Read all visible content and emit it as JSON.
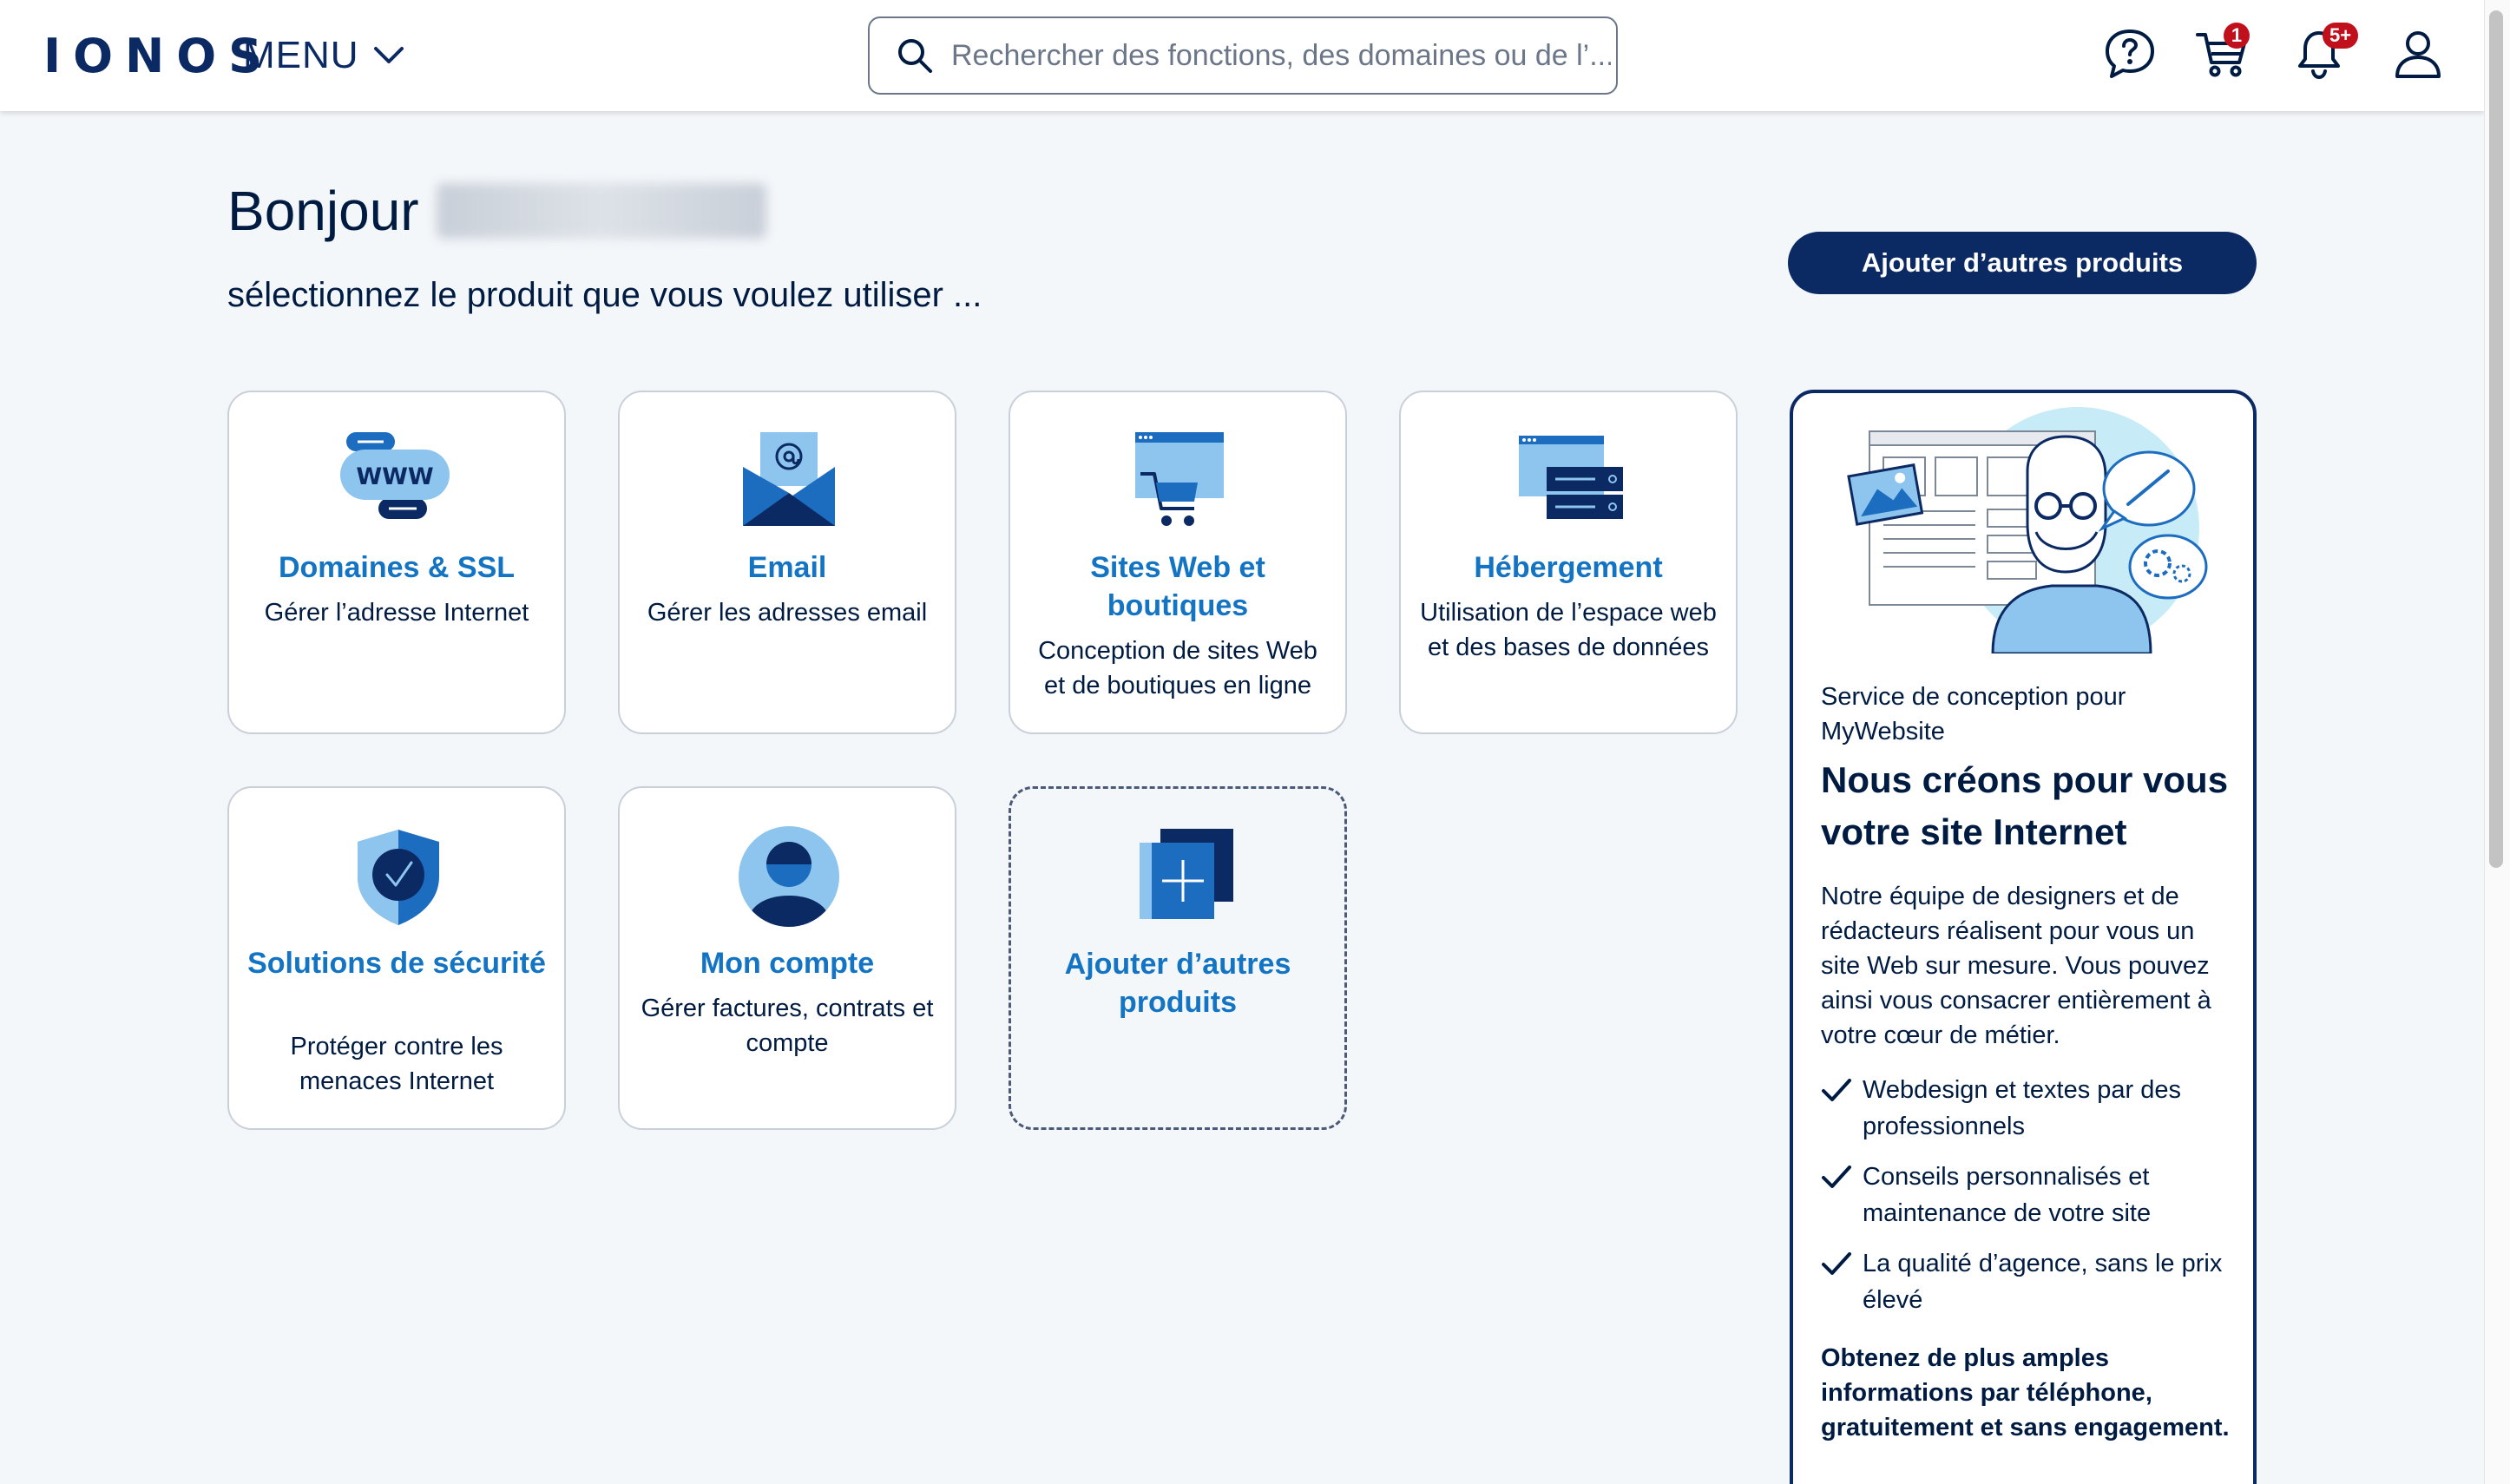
{
  "header": {
    "logo": "IONOS",
    "menu_label": "MENU",
    "search_placeholder": "Rechercher des fonctions, des domaines ou de l’...",
    "cart_badge": "1",
    "notifications_badge": "5+"
  },
  "greeting": {
    "hello": "Bonjour",
    "subtitle": "sélectionnez le produit que vous voulez utiliser ..."
  },
  "add_products_button": "Ajouter d’autres produits",
  "products": [
    {
      "title": "Domaines & SSL",
      "desc": "Gérer l’adresse Internet"
    },
    {
      "title": "Email",
      "desc": "Gérer les adresses email"
    },
    {
      "title": "Sites Web et boutiques",
      "desc": "Conception de sites Web et de boutiques en ligne"
    },
    {
      "title": "Hébergement",
      "desc": "Utilisation de l’espace web et des bases de données"
    },
    {
      "title": "Solutions de sécurité",
      "desc": "Protéger contre les menaces Internet"
    },
    {
      "title": "Mon compte",
      "desc": "Gérer factures, contrats et compte"
    },
    {
      "title": "Ajouter d’autres produits",
      "desc": ""
    }
  ],
  "promo": {
    "kicker": "Service de conception pour MyWebsite",
    "headline": "Nous créons pour vous votre site Internet",
    "body": "Notre équipe de designers et de rédacteurs réalisent pour vous un site Web sur mesure. Vous pouvez ainsi vous consacrer entièrement à votre cœur de métier.",
    "bullets": [
      "Webdesign et textes par des professionnels",
      "Conseils personnalisés et maintenance de votre site",
      "La qualité d’agence, sans le prix élevé"
    ],
    "cta": "Obtenez de plus amples informations par téléphone, gratuitement et sans engagement."
  },
  "colors": {
    "brand_navy": "#0b2a63",
    "link_blue": "#1474c4",
    "light_blue": "#8ec5ee",
    "badge_red": "#c0101b",
    "page_bg": "#f4f7fa"
  },
  "icons": [
    "search-icon",
    "help-chat-icon",
    "cart-icon",
    "bell-icon",
    "user-icon",
    "chevron-down-icon",
    "checkmark-icon"
  ]
}
